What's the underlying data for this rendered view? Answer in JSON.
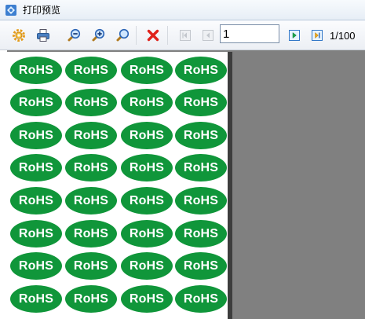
{
  "window": {
    "title": "打印预览",
    "app_icon": "print-preview-app-icon"
  },
  "toolbar": {
    "buttons": [
      {
        "name": "settings-button",
        "icon": "gear-icon"
      },
      {
        "name": "print-button",
        "icon": "printer-icon"
      },
      {
        "name": "zoom-out-button",
        "icon": "zoom-out-icon"
      },
      {
        "name": "zoom-in-button",
        "icon": "zoom-in-icon"
      },
      {
        "name": "zoom-actual-button",
        "icon": "magnifier-icon"
      },
      {
        "name": "close-button",
        "icon": "red-x-icon"
      },
      {
        "name": "first-page-button",
        "icon": "first-page-icon",
        "disabled": true
      },
      {
        "name": "prev-page-button",
        "icon": "prev-page-icon",
        "disabled": true
      },
      {
        "name": "next-page-button",
        "icon": "next-page-icon"
      },
      {
        "name": "last-page-button",
        "icon": "last-page-icon"
      }
    ],
    "page_input_value": "1",
    "page_count": "1/100"
  },
  "preview": {
    "label_text": "RoHS",
    "label_color": "#10963a",
    "rows": 8,
    "columns": 4
  }
}
